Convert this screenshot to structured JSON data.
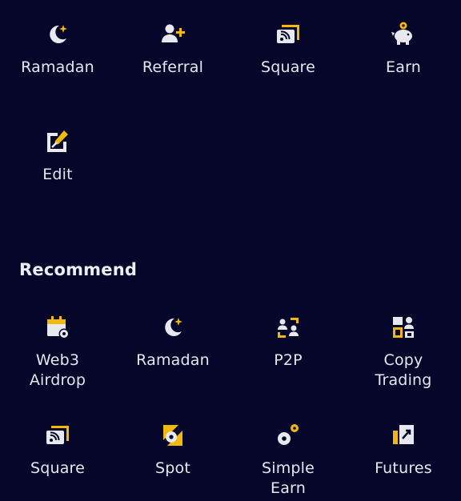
{
  "colors": {
    "background": "#05062a",
    "icon_light": "#e8e9ee",
    "accent": "#f0b90b",
    "text": "#e6e7ee"
  },
  "favorites": {
    "items": [
      {
        "label": "Ramadan",
        "icon": "moon-star-icon"
      },
      {
        "label": "Referral",
        "icon": "add-user-icon"
      },
      {
        "label": "Square",
        "icon": "broadcast-square-icon"
      },
      {
        "label": "Earn",
        "icon": "piggy-bank-icon"
      },
      {
        "label": "Edit",
        "icon": "edit-icon"
      }
    ]
  },
  "recommend": {
    "title": "Recommend",
    "items": [
      {
        "label": "Web3\nAirdrop",
        "icon": "calendar-airdrop-icon"
      },
      {
        "label": "Ramadan",
        "icon": "moon-star-icon"
      },
      {
        "label": "P2P",
        "icon": "p2p-users-icon"
      },
      {
        "label": "Copy\nTrading",
        "icon": "copy-trading-icon"
      },
      {
        "label": "Square",
        "icon": "broadcast-square-icon"
      },
      {
        "label": "Spot",
        "icon": "spot-icon"
      },
      {
        "label": "Simple\nEarn",
        "icon": "simple-earn-icon"
      },
      {
        "label": "Futures",
        "icon": "futures-icon"
      }
    ]
  }
}
